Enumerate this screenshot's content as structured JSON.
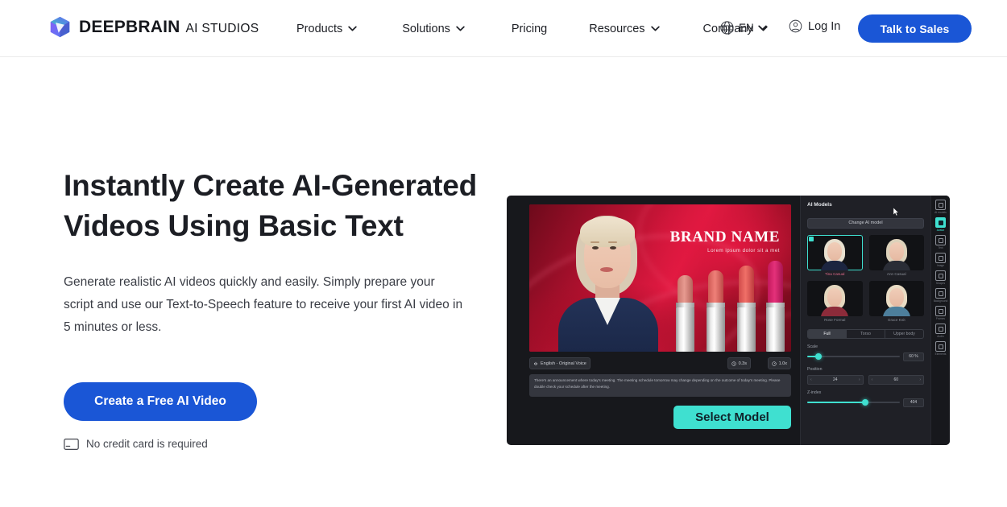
{
  "header": {
    "logo": {
      "icon": "cube-logo-icon",
      "main": "DEEPBRAIN",
      "sub": "AI STUDIOS"
    },
    "nav": [
      {
        "label": "Products",
        "has_dropdown": true
      },
      {
        "label": "Solutions",
        "has_dropdown": true
      },
      {
        "label": "Pricing",
        "has_dropdown": false
      },
      {
        "label": "Resources",
        "has_dropdown": true
      },
      {
        "label": "Company",
        "has_dropdown": true
      }
    ],
    "language": {
      "icon": "globe-icon",
      "label": "EN"
    },
    "login": {
      "icon": "user-circle-icon",
      "label": "Log In"
    },
    "cta": {
      "label": "Talk to Sales",
      "color": "#1a56d6"
    }
  },
  "hero": {
    "title": "Instantly Create AI-Generated Videos Using Basic Text",
    "description": "Generate realistic AI videos quickly and easily. Simply prepare your script and use our Text-to-Speech feature to receive your first AI video in 5 minutes or less.",
    "cta": {
      "label": "Create a Free AI Video",
      "color": "#1a56d6"
    },
    "note": {
      "icon": "credit-card-icon",
      "label": "No credit card is required"
    }
  },
  "app": {
    "canvas": {
      "brand_name": "BRAND NAME",
      "brand_tagline": "Lorem ipsum dolor sit a met"
    },
    "toolbar": {
      "voice": {
        "icon": "voice-icon",
        "label": "English - Original Voice"
      },
      "pill_a": {
        "icon": "clock-icon",
        "label": "0.3s"
      },
      "pill_b": {
        "icon": "speed-icon",
        "label": "1.0x"
      }
    },
    "script": "There's an announcement where today's meeting. The meeting schedule tomorrow may change depending on the outcome of today's meeting. Please double check your schedule after the meeting.",
    "select_model_button": {
      "label": "Select Model",
      "color": "#3fe0d0"
    },
    "panel": {
      "title": "AI Models",
      "change_button": "Change AI model",
      "models": [
        {
          "name": "Tina Casual",
          "selected": true,
          "hair": "#e8e0cf",
          "body": "#1c2540"
        },
        {
          "name": "Ann Casual",
          "selected": false,
          "hair": "#ddd2bb",
          "body": "#2a2d36"
        },
        {
          "name": "Rose Formal",
          "selected": false,
          "hair": "#e3d6bd",
          "body": "#8d2b3a"
        },
        {
          "name": "Grace Knit",
          "selected": false,
          "hair": "#e9dcc4",
          "body": "#4d7f9c"
        }
      ],
      "size_segments": [
        {
          "label": "Full",
          "active": true
        },
        {
          "label": "Torso",
          "active": false
        },
        {
          "label": "Upper body",
          "active": false
        }
      ],
      "scale": {
        "label": "Scale",
        "value": "60 %",
        "percent": 12
      },
      "position": {
        "label": "Position",
        "x": "24",
        "y": "60"
      },
      "z_index": {
        "label": "Z-index",
        "value": "404",
        "percent": 62
      }
    },
    "rail": [
      {
        "icon": "avatar-icon",
        "label": "AI models",
        "active": false
      },
      {
        "icon": "person-icon",
        "label": "Avatar",
        "active": true
      },
      {
        "icon": "text-icon",
        "label": "Text",
        "active": false
      },
      {
        "icon": "image-icon",
        "label": "Image",
        "active": false
      },
      {
        "icon": "shape-icon",
        "label": "Shapes",
        "active": false
      },
      {
        "icon": "background-icon",
        "label": "Background",
        "active": false
      },
      {
        "icon": "frame-icon",
        "label": "Frames",
        "active": false
      },
      {
        "icon": "audio-icon",
        "label": "Audio",
        "active": false
      },
      {
        "icon": "element-icon",
        "label": "Elements",
        "active": false
      }
    ]
  }
}
